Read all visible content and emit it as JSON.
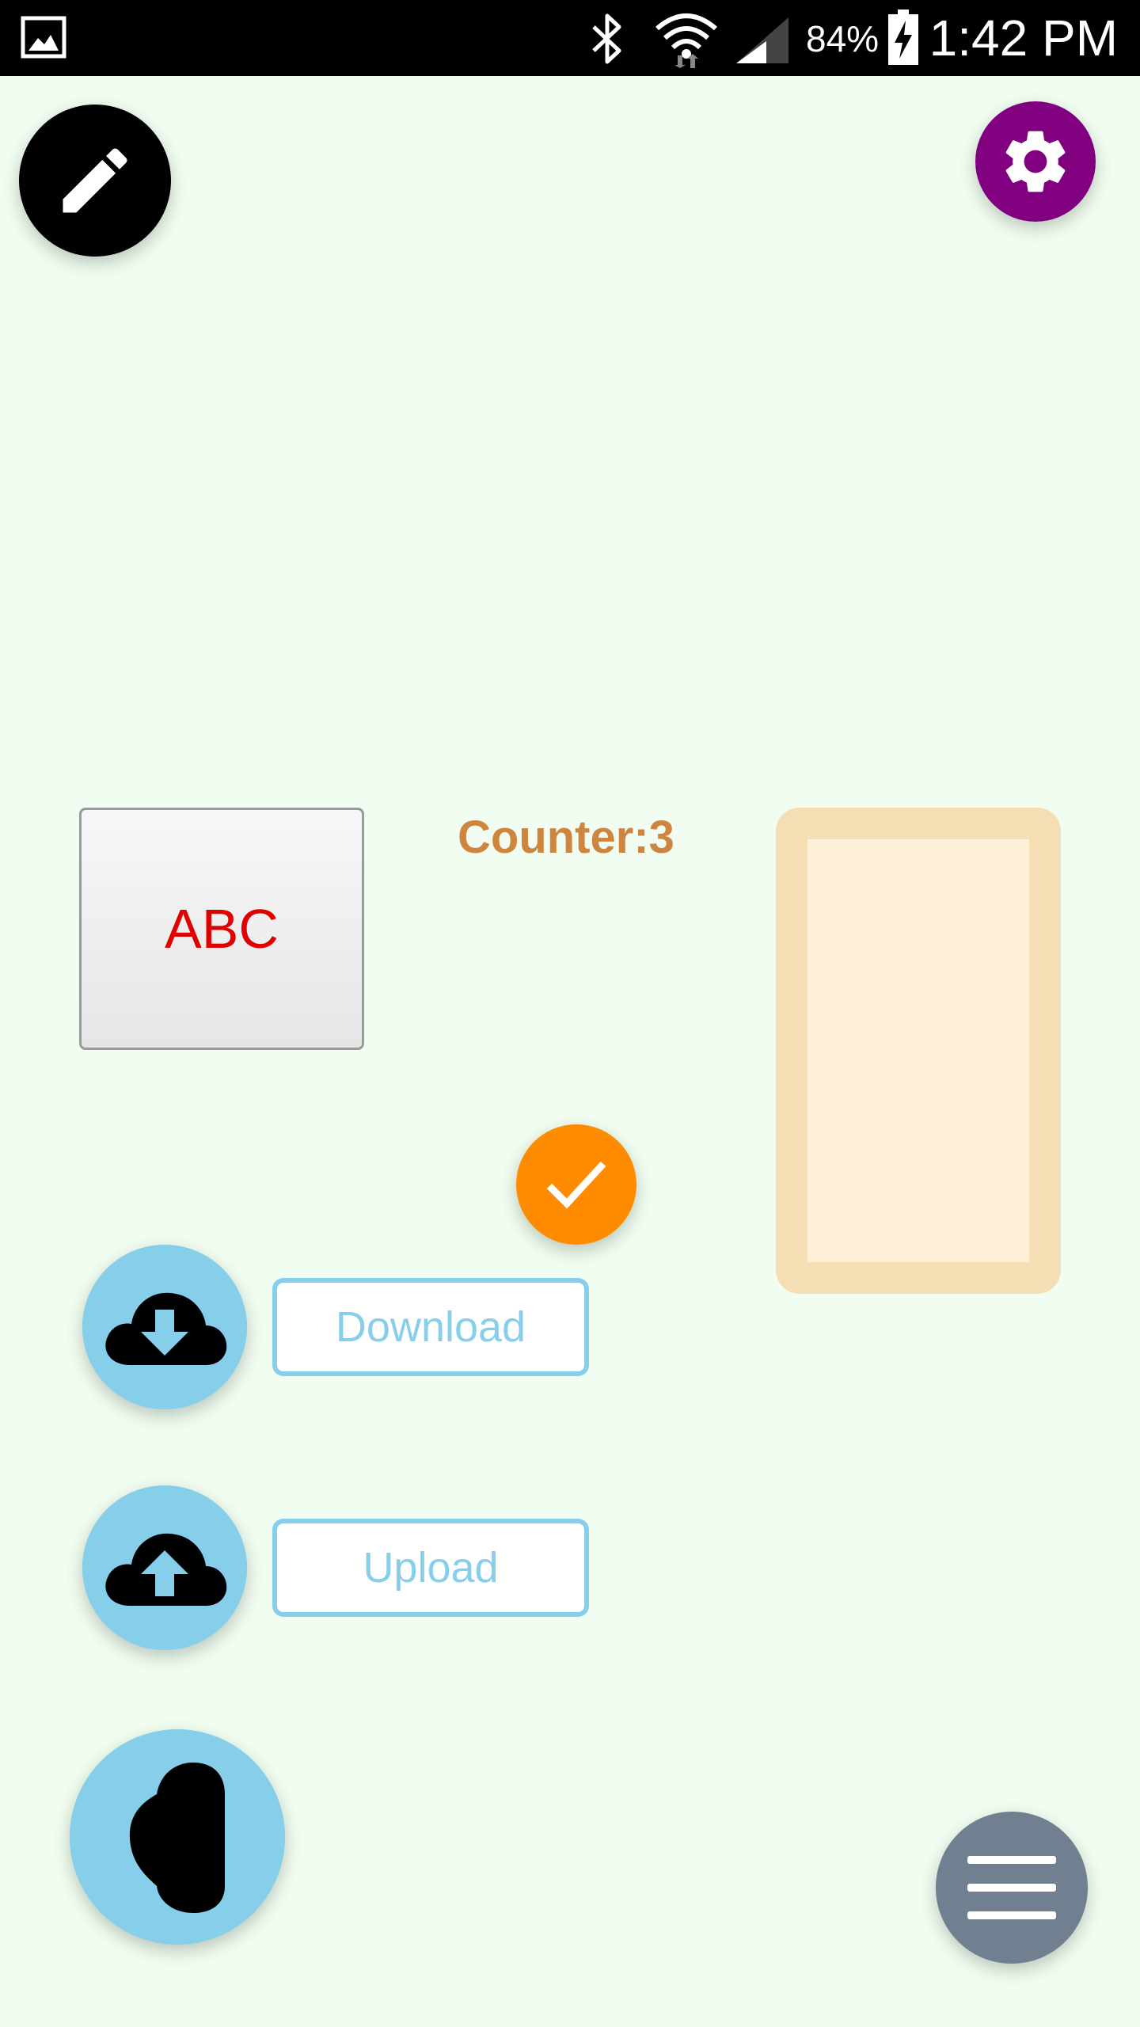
{
  "status_bar": {
    "battery_text": "84%",
    "time": "1:42 PM",
    "icons": [
      "gallery-icon",
      "bluetooth-icon",
      "wifi-icon",
      "cell-signal-icon",
      "battery-charging-icon"
    ]
  },
  "edit_button": {
    "icon": "pencil-icon",
    "color": "#000000"
  },
  "settings_button": {
    "icon": "gear-icon",
    "color": "#800080"
  },
  "abc_button": {
    "label": "ABC",
    "text_color": "#e00000"
  },
  "counter": {
    "label": "Counter:3",
    "color": "#cd853f"
  },
  "beige_panel": {
    "border_color": "#f5deb3",
    "fill_color": "#fdf0d6"
  },
  "check_button": {
    "icon": "check-icon",
    "color": "#ff8c00"
  },
  "download": {
    "icon": "cloud-download-icon",
    "label": "Download"
  },
  "upload": {
    "icon": "cloud-upload-icon",
    "label": "Upload"
  },
  "blob_button": {
    "icon": "blob-icon",
    "color": "#87ceeb"
  },
  "menu_button": {
    "icon": "hamburger-menu-icon",
    "color": "#708090"
  },
  "colors": {
    "background": "#f0fdf0",
    "accent_blue": "#87ceeb"
  }
}
